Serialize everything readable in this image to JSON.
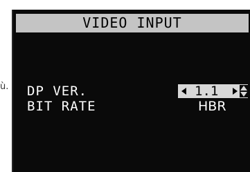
{
  "page": {
    "stray_text": "ù."
  },
  "osd": {
    "title": "VIDEO INPUT",
    "settings": [
      {
        "label": "DP VER.",
        "value": "1.1",
        "selected": true
      },
      {
        "label": "BIT RATE",
        "value": "HBR",
        "selected": false
      }
    ]
  },
  "icons": {
    "left_arrow": "arrow-left-icon",
    "right_arrow": "arrow-right-icon",
    "up_down": "up-down-arrows-icon"
  },
  "colors": {
    "osd_background": "#0a0a0a",
    "title_bar": "#c4c4c4",
    "selected_value_background": "#d8d8d8",
    "text": "#ffffff"
  }
}
